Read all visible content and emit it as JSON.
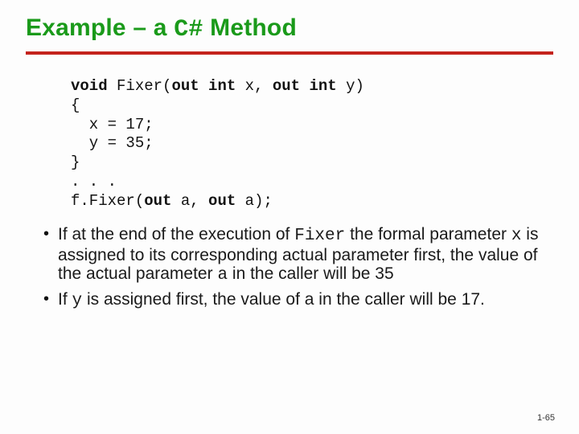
{
  "title": {
    "pre": "Example – a ",
    "mono": "C#",
    "post": " Method"
  },
  "code": {
    "l1a": "void",
    "l1b": " Fixer(",
    "l1c": "out int",
    "l1d": " x, ",
    "l1e": "out int",
    "l1f": " y)",
    "l2": "{",
    "l3": "  x = 17;",
    "l4": "  y = 35;",
    "l5": "}",
    "l6": ". . .",
    "l7a": "f.Fixer(",
    "l7b": "out",
    "l7c": " a, ",
    "l7d": "out",
    "l7e": " a);"
  },
  "bullets": {
    "b1": {
      "t1": "If at the end of the execution of ",
      "m1": "Fixer",
      "t2": " the formal parameter ",
      "m2": "x",
      "t3": " is assigned to its corresponding actual parameter first, the value of the actual parameter ",
      "m3": "a",
      "t4": " in the caller will be 35"
    },
    "b2": {
      "t1": "If ",
      "m1": "y",
      "t2": " is assigned first, the value of a in the caller will be 17."
    }
  },
  "footer": "1-65"
}
